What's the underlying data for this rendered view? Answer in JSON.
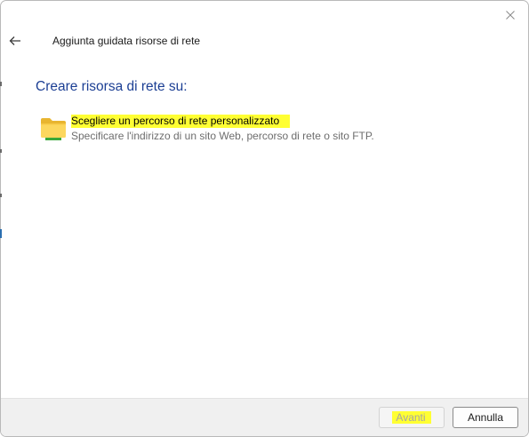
{
  "window": {
    "title": "Aggiunta guidata risorse di rete"
  },
  "main": {
    "heading": "Creare risorsa di rete su:",
    "option": {
      "title": "Scegliere un percorso di rete personalizzato",
      "description": "Specificare l'indirizzo di un sito Web, percorso di rete o sito FTP.",
      "icon": "folder-icon"
    }
  },
  "footer": {
    "next_label": "Avanti",
    "cancel_label": "Annulla"
  },
  "icons": {
    "close": "close-icon",
    "back": "back-arrow-icon"
  },
  "colors": {
    "heading": "#1c3f94",
    "highlight": "#ffff33",
    "description": "#6d6d6d"
  }
}
